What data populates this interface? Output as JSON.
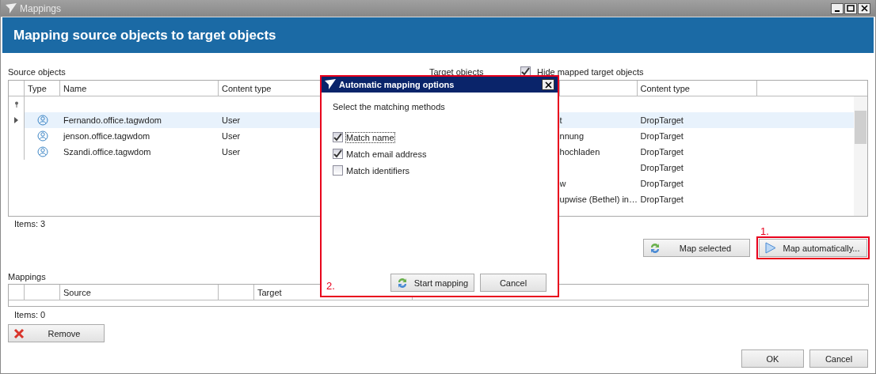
{
  "window": {
    "title": "Mappings"
  },
  "header": {
    "title": "Mapping source objects to target objects"
  },
  "source": {
    "label": "Source objects",
    "columns": [
      "Type",
      "Name",
      "Content type"
    ],
    "rows": [
      {
        "name": "Fernando.office.tagwdom",
        "content_type": "User",
        "selected": true
      },
      {
        "name": "jenson.office.tagwdom",
        "content_type": "User",
        "selected": false
      },
      {
        "name": "Szandi.office.tagwdom",
        "content_type": "User",
        "selected": false
      }
    ],
    "items": "Items: 3"
  },
  "target": {
    "label": "Target objects",
    "hide_mapped": {
      "label": "Hide mapped target objects",
      "checked": true
    },
    "columns": [
      "Content type"
    ],
    "rows": [
      {
        "name": "t",
        "content_type": "DropTarget",
        "selected": true
      },
      {
        "name": "nnung",
        "content_type": "DropTarget",
        "selected": false
      },
      {
        "name": "hochladen",
        "content_type": "DropTarget",
        "selected": false
      },
      {
        "name": "",
        "content_type": "DropTarget",
        "selected": false
      },
      {
        "name": "w",
        "content_type": "DropTarget",
        "selected": false
      },
      {
        "name": "upwise (Bethel) in…",
        "content_type": "DropTarget",
        "selected": false
      }
    ]
  },
  "actions": [
    {
      "label": "Map selected",
      "kind": "sync",
      "highlighted": false
    },
    {
      "label": "Map automatically...",
      "kind": "play",
      "highlighted": true,
      "step": "1."
    }
  ],
  "mappings": {
    "label": "Mappings",
    "columns": [
      "Source",
      "Target"
    ],
    "items": "Items: 0"
  },
  "remove": {
    "label": "Remove"
  },
  "footer": [
    "OK",
    "Cancel"
  ],
  "dialog": {
    "title": "Automatic mapping options",
    "prompt": "Select the matching methods",
    "step": "2.",
    "options": [
      {
        "label": "Match name",
        "checked": true,
        "focused": true
      },
      {
        "label": "Match email address",
        "checked": true,
        "focused": false
      },
      {
        "label": "Match identifiers",
        "checked": false,
        "focused": false
      }
    ],
    "buttons": [
      {
        "label": "Start mapping",
        "kind": "sync"
      },
      {
        "label": "Cancel",
        "kind": "plain"
      }
    ]
  }
}
